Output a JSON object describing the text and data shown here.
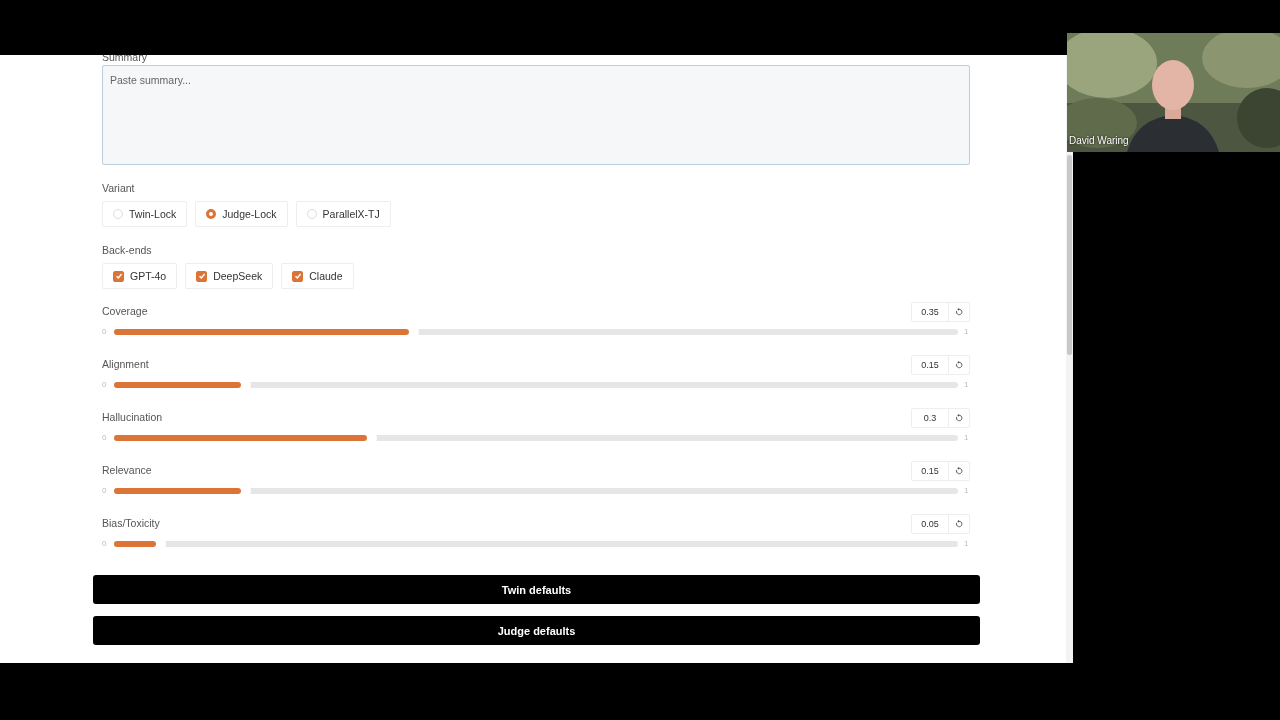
{
  "summary": {
    "label": "Summary",
    "placeholder": "Paste summary..."
  },
  "variant": {
    "label": "Variant",
    "options": [
      {
        "label": "Twin-Lock",
        "selected": false
      },
      {
        "label": "Judge-Lock",
        "selected": true
      },
      {
        "label": "ParallelX-TJ",
        "selected": false
      }
    ]
  },
  "backends": {
    "label": "Back-ends",
    "options": [
      {
        "label": "GPT-4o",
        "checked": true
      },
      {
        "label": "DeepSeek",
        "checked": true
      },
      {
        "label": "Claude",
        "checked": true
      }
    ]
  },
  "sliders": [
    {
      "name": "Coverage",
      "min": "0",
      "max": "1",
      "reading": "0.35",
      "level": 0.35
    },
    {
      "name": "Alignment",
      "min": "0",
      "max": "1",
      "reading": "0.15",
      "level": 0.15
    },
    {
      "name": "Hallucination",
      "min": "0",
      "max": "1",
      "reading": "0.3",
      "level": 0.3
    },
    {
      "name": "Relevance",
      "min": "0",
      "max": "1",
      "reading": "0.15",
      "level": 0.15
    },
    {
      "name": "Bias/Toxicity",
      "min": "0",
      "max": "1",
      "reading": "0.05",
      "level": 0.05
    }
  ],
  "buttons": [
    "Twin defaults",
    "Judge defaults"
  ],
  "video": {
    "name": "David Waring"
  }
}
